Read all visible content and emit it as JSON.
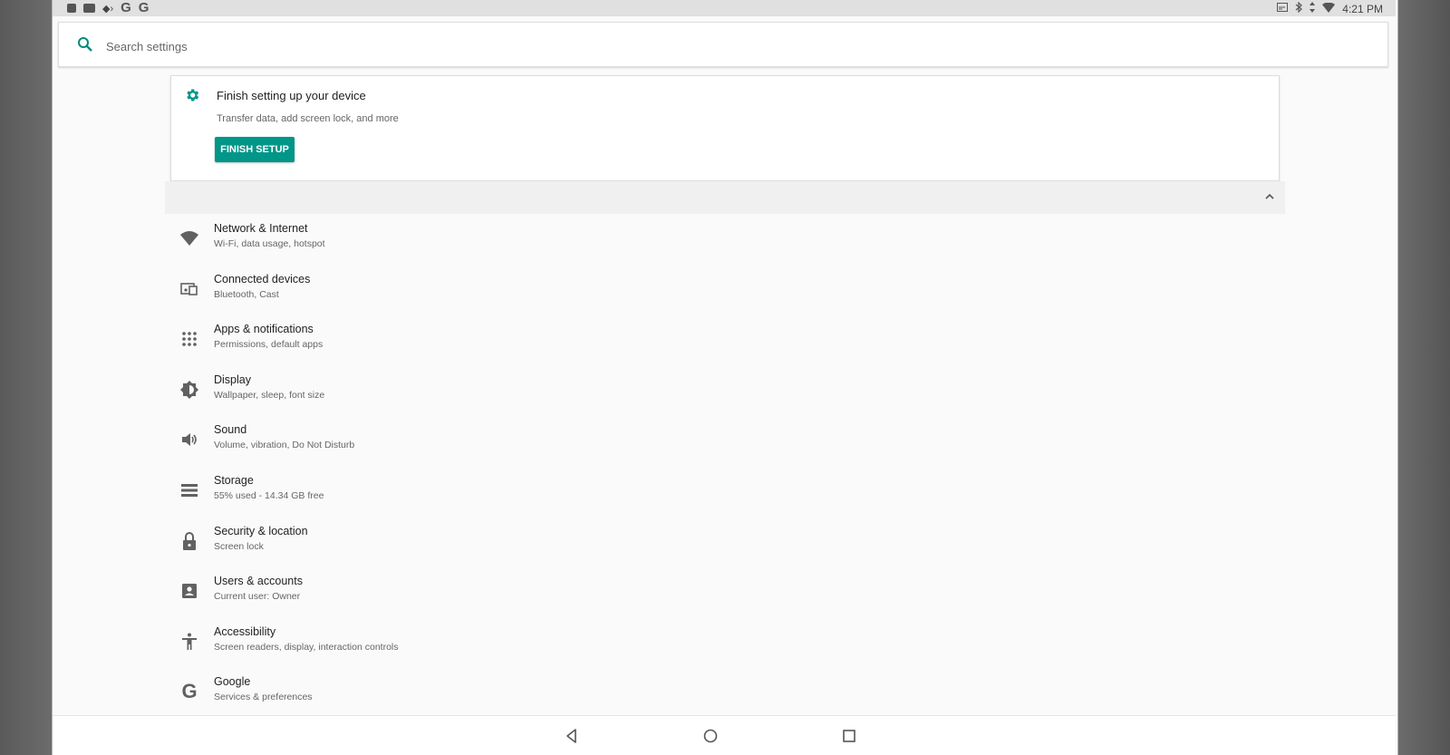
{
  "status_bar": {
    "time": "4:21 PM",
    "left_icons": [
      "notification-icon",
      "mail-icon",
      "transfer-icon",
      "google-g-icon",
      "google-g-icon"
    ],
    "left_g1": "G",
    "left_g2": "G",
    "right_icons": [
      "cast-icon",
      "bluetooth-icon",
      "data-icon",
      "wifi-icon"
    ]
  },
  "search": {
    "placeholder": "Search settings",
    "icon": "search-icon"
  },
  "setup_card": {
    "title": "Finish setting up your device",
    "subtitle": "Transfer data, add screen lock, and more",
    "button_label": "FINISH SETUP",
    "icon": "gear-icon"
  },
  "settings": [
    {
      "title": "Network & Internet",
      "subtitle": "Wi-Fi, data usage, hotspot",
      "icon": "wifi-icon"
    },
    {
      "title": "Connected devices",
      "subtitle": "Bluetooth, Cast",
      "icon": "devices-icon"
    },
    {
      "title": "Apps & notifications",
      "subtitle": "Permissions, default apps",
      "icon": "apps-grid-icon"
    },
    {
      "title": "Display",
      "subtitle": "Wallpaper, sleep, font size",
      "icon": "brightness-icon"
    },
    {
      "title": "Sound",
      "subtitle": "Volume, vibration, Do Not Disturb",
      "icon": "volume-icon"
    },
    {
      "title": "Storage",
      "subtitle": "55% used - 14.34 GB free",
      "icon": "storage-icon"
    },
    {
      "title": "Security & location",
      "subtitle": "Screen lock",
      "icon": "lock-icon"
    },
    {
      "title": "Users & accounts",
      "subtitle": "Current user: Owner",
      "icon": "account-icon"
    },
    {
      "title": "Accessibility",
      "subtitle": "Screen readers, display, interaction controls",
      "icon": "accessibility-icon"
    },
    {
      "title": "Google",
      "subtitle": "Services & preferences",
      "icon": "google-icon"
    }
  ],
  "google_glyph": "G",
  "nav": [
    "back-icon",
    "home-icon",
    "recents-icon"
  ],
  "colors": {
    "accent": "#009688",
    "icon": "#616161"
  }
}
